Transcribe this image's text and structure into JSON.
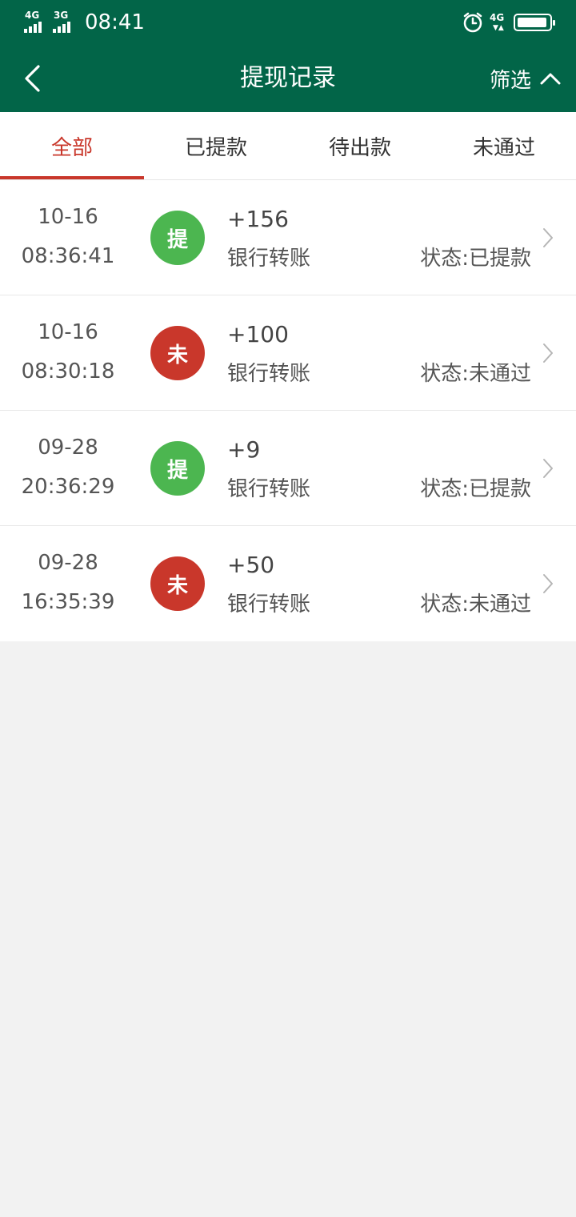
{
  "status_bar": {
    "sim1_tag": "4G",
    "sim2_tag": "3G",
    "time": "08:41",
    "net_tag": "4G",
    "net_arrows": "▼▲"
  },
  "nav": {
    "title": "提现记录",
    "filter_label": "筛选"
  },
  "tabs": [
    {
      "label": "全部",
      "active": true
    },
    {
      "label": "已提款",
      "active": false
    },
    {
      "label": "待出款",
      "active": false
    },
    {
      "label": "未通过",
      "active": false
    }
  ],
  "records": [
    {
      "date": "10-16",
      "time": "08:36:41",
      "badge": "提",
      "badge_color": "#4cb650",
      "amount": "+156",
      "method": "银行转账",
      "status": "状态:已提款"
    },
    {
      "date": "10-16",
      "time": "08:30:18",
      "badge": "未",
      "badge_color": "#c9372b",
      "amount": "+100",
      "method": "银行转账",
      "status": "状态:未通过"
    },
    {
      "date": "09-28",
      "time": "20:36:29",
      "badge": "提",
      "badge_color": "#4cb650",
      "amount": "+9",
      "method": "银行转账",
      "status": "状态:已提款"
    },
    {
      "date": "09-28",
      "time": "16:35:39",
      "badge": "未",
      "badge_color": "#c9372b",
      "amount": "+50",
      "method": "银行转账",
      "status": "状态:未通过"
    }
  ],
  "colors": {
    "header_bg": "#026548",
    "accent_red": "#c9372b",
    "success_green": "#4cb650"
  }
}
